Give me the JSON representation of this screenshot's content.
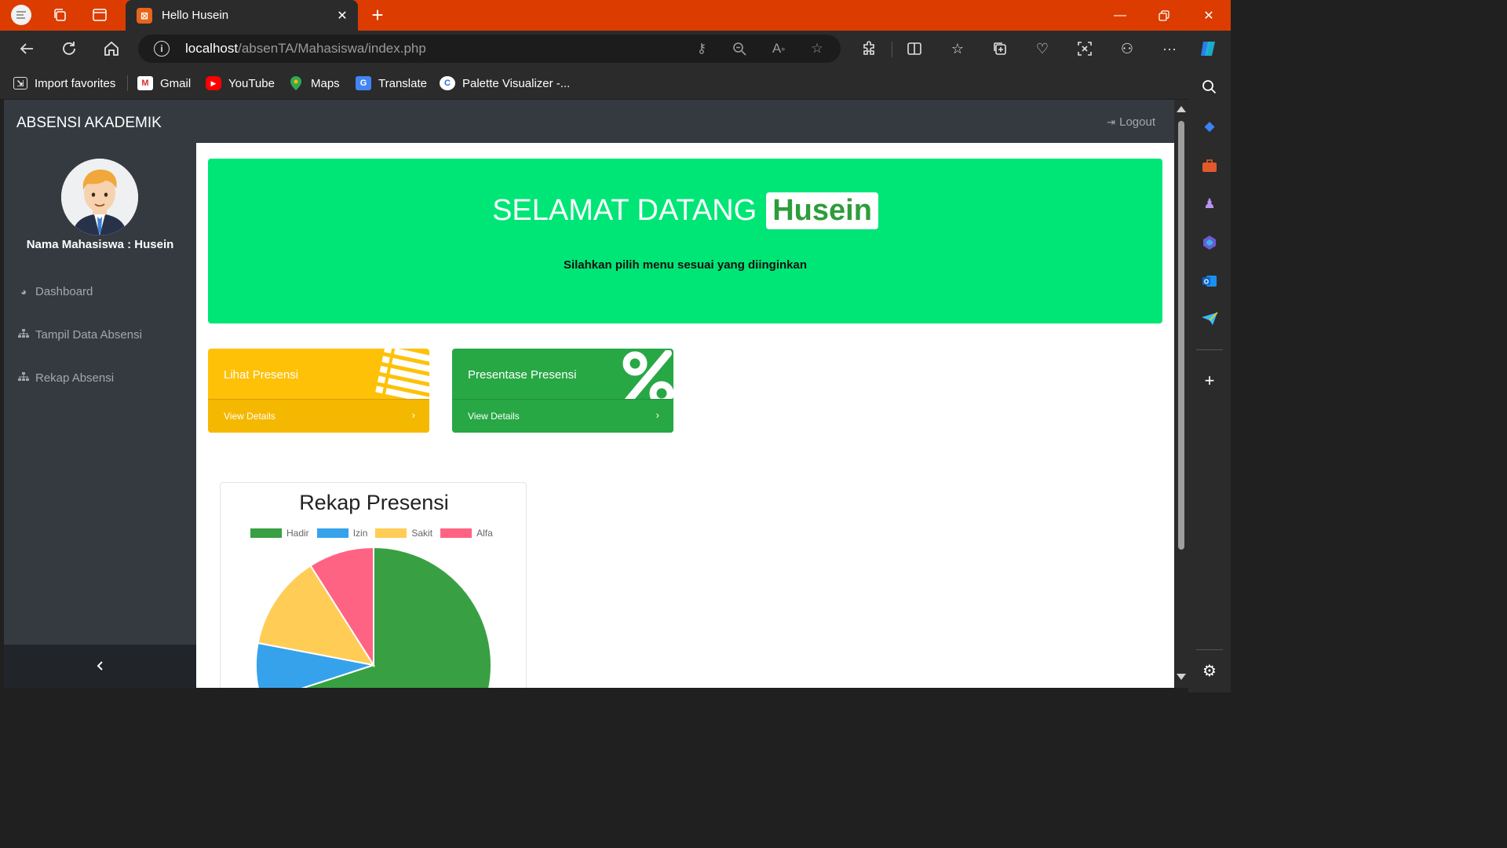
{
  "browser": {
    "tab_title": "Hello Husein",
    "url_host": "localhost",
    "url_path": "/absenTA/Mahasiswa/index.php",
    "bookmarks": [
      {
        "label": "Import favorites",
        "icon": "import-icon"
      },
      {
        "label": "Gmail",
        "icon": "gmail-icon"
      },
      {
        "label": "YouTube",
        "icon": "youtube-icon"
      },
      {
        "label": "Maps",
        "icon": "maps-icon"
      },
      {
        "label": "Translate",
        "icon": "translate-icon"
      },
      {
        "label": "Palette Visualizer -...",
        "icon": "palette-icon"
      }
    ]
  },
  "app": {
    "brand": "ABSENSI AKADEMIK",
    "logout_label": "Logout",
    "student_label": "Nama Mahasiswa : Husein",
    "menu": [
      {
        "label": "Dashboard",
        "icon": "dashboard-icon"
      },
      {
        "label": "Tampil Data Absensi",
        "icon": "sitemap-icon"
      },
      {
        "label": "Rekap Absensi",
        "icon": "sitemap-icon"
      }
    ],
    "collapse_icon": "chevron-left-icon"
  },
  "welcome": {
    "title": "SELAMAT DATANG",
    "name": "Husein",
    "subtitle": "Silahkan pilih menu sesuai yang diinginkan"
  },
  "cards": [
    {
      "title": "Lihat Presensi",
      "link": "View Details",
      "icon": "list-icon",
      "color": "#ffc107"
    },
    {
      "title": "Presentase Presensi",
      "link": "View Details",
      "icon": "percent-icon",
      "color": "#28a745"
    }
  ],
  "chart_data": {
    "type": "pie",
    "title": "Rekap Presensi",
    "legend_position": "top",
    "categories": [
      "Hadir",
      "Izin",
      "Sakit",
      "Alfa"
    ],
    "values": [
      70,
      8,
      13,
      9
    ],
    "colors": [
      "#38a042",
      "#36a2eb",
      "#ffcd56",
      "#ff6384"
    ]
  }
}
